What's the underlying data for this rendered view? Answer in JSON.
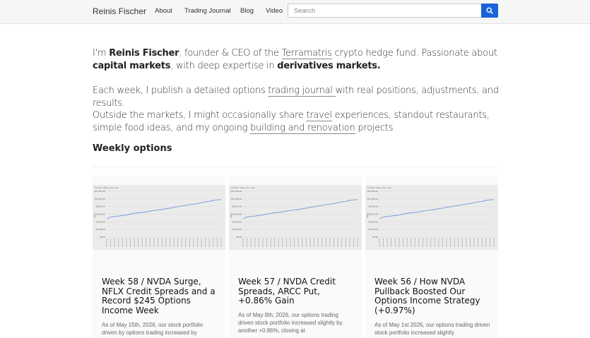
{
  "header": {
    "brand": "Reinis Fischer",
    "nav": [
      "About",
      "Trading Journal",
      "Blog",
      "Video"
    ],
    "search_placeholder": "Search"
  },
  "intro": {
    "p1": {
      "a": "I'm ",
      "name": "Reinis Fischer",
      "b": ", founder & CEO of the ",
      "company": "Terramatris",
      "c": " crypto hedge fund. Passionate about ",
      "capital": "capital markets",
      "d": ", with deep expertise in ",
      "derivatives": "derivatives markets."
    },
    "p2": {
      "a": "Each week, I publish a detailed options ",
      "link": "trading journal ",
      "b": "with real positions, adjustments, and results."
    },
    "p3": {
      "a": "Outside the markets, I might occasionally share ",
      "travel": "travel",
      "b": " experiences, standout restaurants, simple food ideas, and my ongoing ",
      "building": "building and renovation",
      "c": " projects"
    }
  },
  "section_title": "Weekly options",
  "cards": [
    {
      "title": "Week 58 / NVDA Surge, NFLX Credit Spreads and a Record $245 Options Income Week",
      "excerpt": "As of May 15th, 2026, our stock portfolio driven by options trading increased by"
    },
    {
      "title": "Week 57 / NVDA Credit Spreads, ARCC Put, +0.86% Gain",
      "excerpt": "As of May 8th, 2026, our options trading driven stock portfolio increased slightly by another +0.86%, closing at"
    },
    {
      "title": "Week 56 / How NVDA Pullback Boosted Our Options Income Strategy (+0.97%)",
      "excerpt": "As of May 1st 2026, our options trading driven stock portfolio increased slightly"
    }
  ],
  "thumbnail_chart": {
    "title": "Portfolio Value Over Time",
    "yticks": [
      "$12,000.00",
      "$10,000.00",
      "$8,000.00",
      "$6,000.00",
      "$4,000.00",
      "$2,000.00",
      "$0.00"
    ],
    "ylabel": "Value",
    "values": [
      0.4,
      0.44,
      0.45,
      0.46,
      0.47,
      0.48,
      0.5,
      0.52,
      0.53,
      0.54,
      0.55,
      0.57,
      0.58,
      0.59,
      0.6,
      0.62,
      0.63,
      0.65,
      0.66,
      0.68,
      0.69,
      0.71,
      0.72,
      0.73,
      0.75,
      0.77,
      0.78,
      0.8,
      0.81,
      0.82
    ]
  },
  "colors": {
    "accent": "#1a63d8",
    "chart_line": "#6f9ad8"
  }
}
